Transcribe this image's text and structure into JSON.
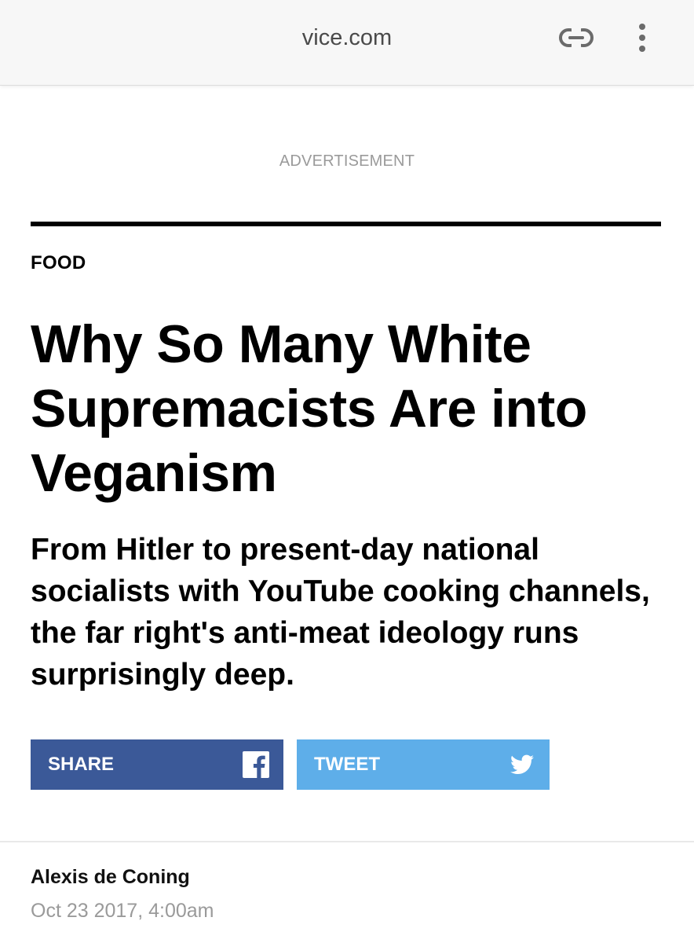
{
  "browser": {
    "url": "vice.com",
    "link_icon": "link-icon",
    "menu_icon": "more-vertical-icon"
  },
  "advertisement_label": "ADVERTISEMENT",
  "article": {
    "section": "FOOD",
    "headline": "Why So Many White Supremacists Are into Veganism",
    "dek": "From Hitler to present-day national socialists with YouTube cooking channels, the far right's anti-meat ideology runs surprisingly deep."
  },
  "share": {
    "facebook": {
      "label": "SHARE",
      "icon": "facebook-icon",
      "color": "#3b5998"
    },
    "twitter": {
      "label": "TWEET",
      "icon": "twitter-bird-icon",
      "color": "#5eaee9"
    }
  },
  "byline": {
    "author": "Alexis de Coning",
    "date": "Oct 23 2017, 4:00am"
  }
}
